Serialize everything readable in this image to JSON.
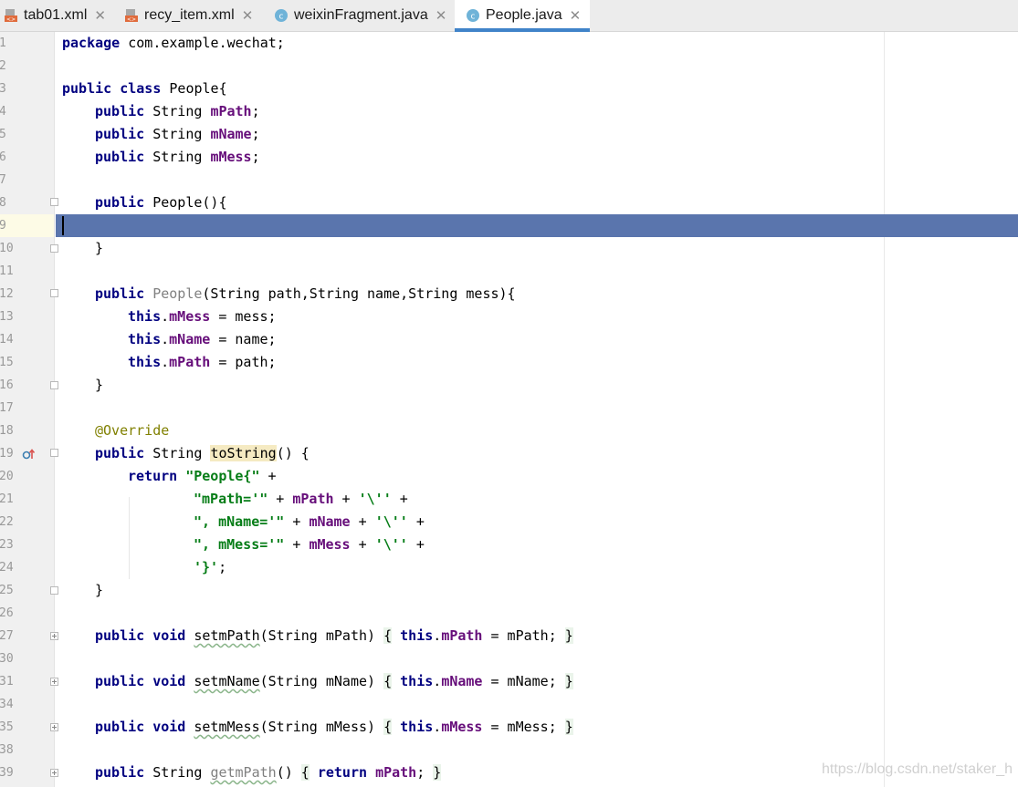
{
  "tabs": [
    {
      "label": "tab01.xml",
      "icon": "xml-file-icon"
    },
    {
      "label": "recy_item.xml",
      "icon": "xml-file-icon"
    },
    {
      "label": "weixinFragment.java",
      "icon": "java-class-icon"
    },
    {
      "label": "People.java",
      "icon": "java-class-icon",
      "active": true
    }
  ],
  "line_numbers": [
    "1",
    "2",
    "3",
    "4",
    "5",
    "6",
    "7",
    "8",
    "9",
    "10",
    "11",
    "12",
    "13",
    "14",
    "15",
    "16",
    "17",
    "18",
    "19",
    "20",
    "21",
    "22",
    "23",
    "24",
    "25",
    "26",
    "27",
    "30",
    "31",
    "34",
    "35",
    "38",
    "39"
  ],
  "code": {
    "l1": {
      "kw": "package",
      "rest": " com.example.wechat;"
    },
    "l3": {
      "kw1": "public",
      "kw2": "class",
      "rest": " People{"
    },
    "l4": {
      "kw": "public",
      "type": " String ",
      "field": "mPath",
      "end": ";"
    },
    "l5": {
      "kw": "public",
      "type": " String ",
      "field": "mName",
      "end": ";"
    },
    "l6": {
      "kw": "public",
      "type": " String ",
      "field": "mMess",
      "end": ";"
    },
    "l8": {
      "kw": "public",
      "rest": " People(){"
    },
    "l10": {
      "rest": "}"
    },
    "l12": {
      "kw": "public",
      "name": "People",
      "rest": "(String path,String name,String mess){"
    },
    "l13": {
      "kw": "this",
      "dot": ".",
      "field": "mMess",
      "rest": " = mess;"
    },
    "l14": {
      "kw": "this",
      "dot": ".",
      "field": "mName",
      "rest": " = name;"
    },
    "l15": {
      "kw": "this",
      "dot": ".",
      "field": "mPath",
      "rest": " = path;"
    },
    "l16": {
      "rest": "}"
    },
    "l18": {
      "ann": "@Override"
    },
    "l19": {
      "kw": "public",
      "type": " String ",
      "name": "toString",
      "rest": "() {"
    },
    "l20": {
      "kw": "return",
      "str": "\"People{\"",
      "rest": " +"
    },
    "l21": {
      "str": "\"mPath='\"",
      "op": " + ",
      "field": "mPath",
      "op2": " + ",
      "str2": "'\\''",
      "rest": " +"
    },
    "l22": {
      "str": "\", mName='\"",
      "op": " + ",
      "field": "mName",
      "op2": " + ",
      "str2": "'\\''",
      "rest": " +"
    },
    "l23": {
      "str": "\", mMess='\"",
      "op": " + ",
      "field": "mMess",
      "op2": " + ",
      "str2": "'\\''",
      "rest": " +"
    },
    "l24": {
      "str": "'}'",
      "rest": ";"
    },
    "l25": {
      "rest": "}"
    },
    "l27": {
      "kw1": "public",
      "kw2": "void",
      "name": "setmPath",
      "params": "(String mPath) ",
      "ob": "{",
      "kw3": " this",
      "dot": ".",
      "field": "mPath",
      "rest": " = mPath; ",
      "cb": "}"
    },
    "l31": {
      "kw1": "public",
      "kw2": "void",
      "name": "setmName",
      "params": "(String mName) ",
      "ob": "{",
      "kw3": " this",
      "dot": ".",
      "field": "mName",
      "rest": " = mName; ",
      "cb": "}"
    },
    "l35": {
      "kw1": "public",
      "kw2": "void",
      "name": "setmMess",
      "params": "(String mMess) ",
      "ob": "{",
      "kw3": " this",
      "dot": ".",
      "field": "mMess",
      "rest": " = mMess; ",
      "cb": "}"
    },
    "l39": {
      "kw": "public",
      "type": " String ",
      "name": "getmPath",
      "params": "() ",
      "ob": "{",
      "kw3": " return ",
      "field": "mPath",
      "rest": "; ",
      "cb": "}"
    }
  },
  "watermark": "https://blog.csdn.net/staker_h",
  "colors": {
    "keyword": "#000080",
    "field": "#660e7a",
    "string": "#067d17",
    "annotation": "#808000",
    "current_line": "#5a75ad",
    "tab_underline": "#4083c9"
  }
}
